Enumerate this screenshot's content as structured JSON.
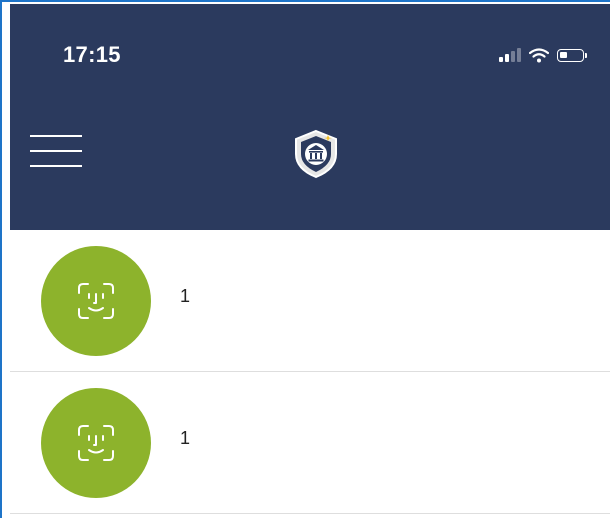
{
  "status_bar": {
    "time": "17:15",
    "icons": [
      "signal-icon",
      "wifi-icon",
      "battery-icon"
    ]
  },
  "header": {
    "background_color": "#2b3a5e",
    "menu_icon": "hamburger-menu-icon",
    "logo_icon": "bank-shield-icon"
  },
  "list": {
    "avatar_color": "#8db32c",
    "avatar_icon": "face-id-icon",
    "items": [
      {
        "label": "1"
      },
      {
        "label": "1"
      }
    ]
  }
}
